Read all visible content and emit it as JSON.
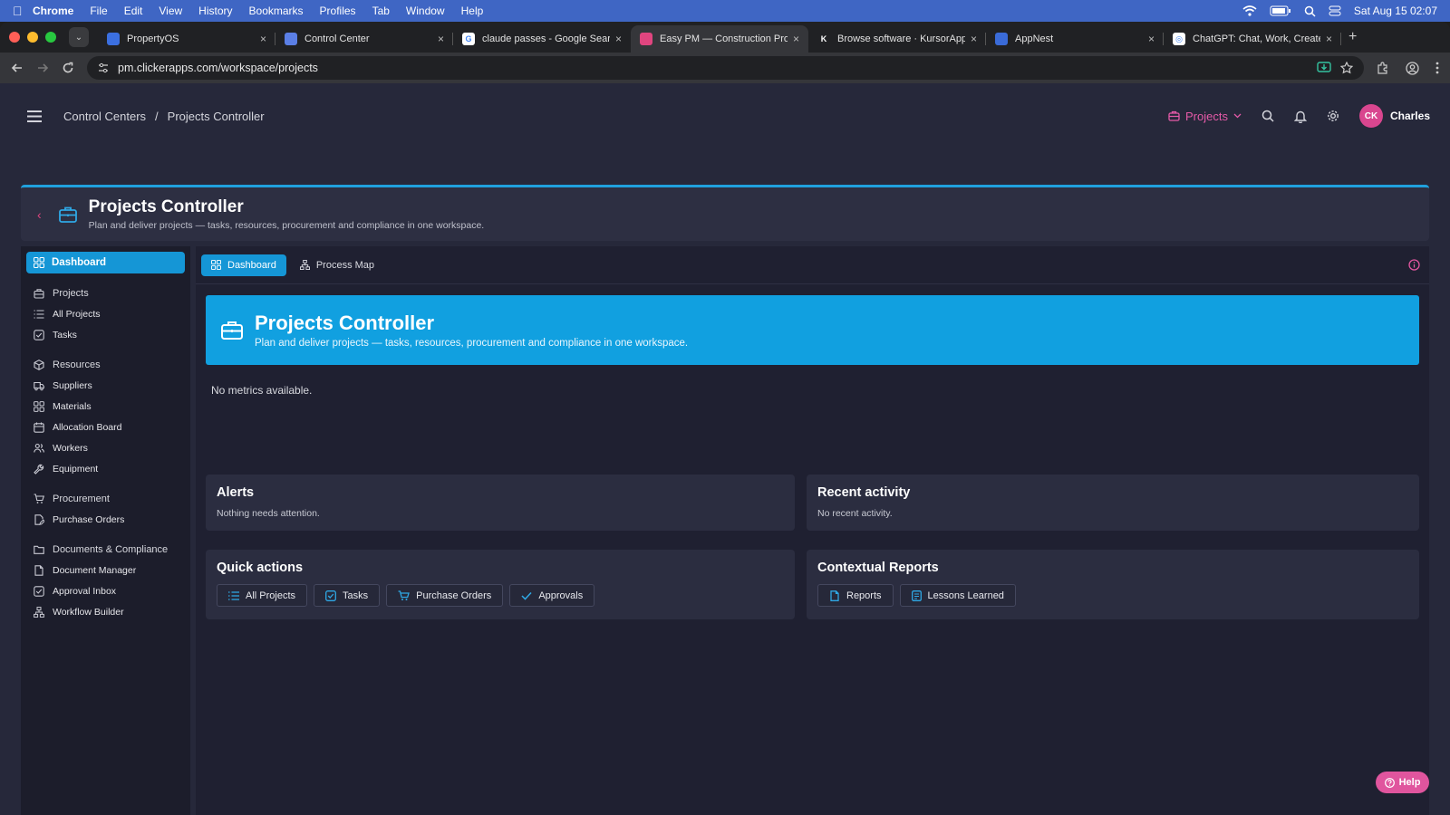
{
  "menubar": {
    "app": "Chrome",
    "items": [
      "File",
      "Edit",
      "View",
      "History",
      "Bookmarks",
      "Profiles",
      "Tab",
      "Window",
      "Help"
    ],
    "datetime": "Sat Aug 15  02:07"
  },
  "browser": {
    "tabs": [
      {
        "title": "PropertyOS",
        "fav_color": "#3b6fe0",
        "fav_text": ""
      },
      {
        "title": "Control Center",
        "fav_color": "#5b7fe6",
        "fav_text": ""
      },
      {
        "title": "claude passes - Google Search",
        "fav_color": "#ffffff",
        "fav_text": "G"
      },
      {
        "title": "Easy PM — Construction Proj",
        "fav_color": "#e0457f",
        "fav_text": ""
      },
      {
        "title": "Browse software · KursorApp",
        "fav_color": "#202124",
        "fav_text": "K"
      },
      {
        "title": "AppNest",
        "fav_color": "#3a6bd8",
        "fav_text": ""
      },
      {
        "title": "ChatGPT: Chat, Work, Create",
        "fav_color": "#ffffff",
        "fav_text": "◎"
      }
    ],
    "active_tab_index": 3,
    "url": "pm.clickerapps.com/workspace/projects"
  },
  "header": {
    "breadcrumb": [
      "Control Centers",
      "Projects Controller"
    ],
    "project_selector": "Projects",
    "user_initials": "CK",
    "user_name": "Charles"
  },
  "page": {
    "title": "Projects Controller",
    "subtitle": "Plan and deliver projects — tasks, resources, procurement and compliance in one workspace."
  },
  "sidebar": {
    "active": "Dashboard",
    "groups": [
      {
        "head": "Projects",
        "icon": "briefcase",
        "items": [
          {
            "label": "All Projects",
            "icon": "list"
          },
          {
            "label": "Tasks",
            "icon": "check"
          }
        ]
      },
      {
        "head": "Resources",
        "icon": "box",
        "items": [
          {
            "label": "Suppliers",
            "icon": "truck"
          },
          {
            "label": "Materials",
            "icon": "grid"
          },
          {
            "label": "Allocation Board",
            "icon": "calendar"
          },
          {
            "label": "Workers",
            "icon": "users"
          },
          {
            "label": "Equipment",
            "icon": "wrench"
          }
        ]
      },
      {
        "head": "Procurement",
        "icon": "cart",
        "items": [
          {
            "label": "Purchase Orders",
            "icon": "doc-edit"
          }
        ]
      },
      {
        "head": "Documents & Compliance",
        "icon": "folder",
        "items": [
          {
            "label": "Document Manager",
            "icon": "doc"
          },
          {
            "label": "Approval Inbox",
            "icon": "check"
          },
          {
            "label": "Workflow Builder",
            "icon": "flow"
          }
        ]
      }
    ]
  },
  "main": {
    "tabs": [
      {
        "label": "Dashboard"
      },
      {
        "label": "Process Map"
      }
    ],
    "hero_title": "Projects Controller",
    "hero_subtitle": "Plan and deliver projects — tasks, resources, procurement and compliance in one workspace.",
    "no_metrics": "No metrics available.",
    "alerts": {
      "title": "Alerts",
      "body": "Nothing needs attention."
    },
    "recent": {
      "title": "Recent activity",
      "body": "No recent activity."
    },
    "quick": {
      "title": "Quick actions",
      "buttons": [
        "All Projects",
        "Tasks",
        "Purchase Orders",
        "Approvals"
      ]
    },
    "reports": {
      "title": "Contextual Reports",
      "buttons": [
        "Reports",
        "Lessons Learned"
      ]
    }
  },
  "help_label": "Help",
  "colors": {
    "accent": "#1596d6",
    "hero": "#11a0e0",
    "pink": "#e0559e"
  }
}
